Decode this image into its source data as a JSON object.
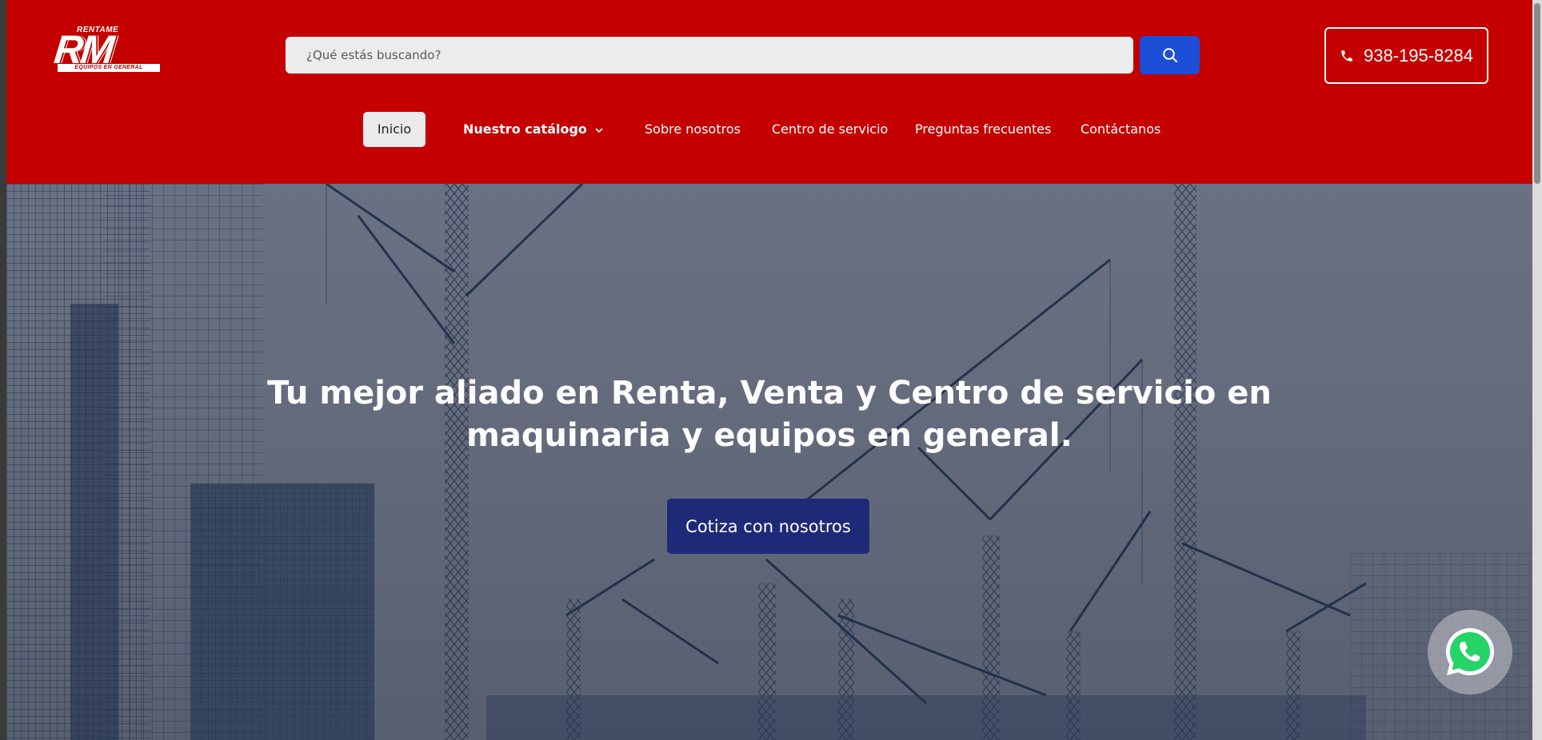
{
  "logo": {
    "brand": "RENTAME",
    "mark": "RM",
    "tagline": "EQUIPOS EN GENERAL"
  },
  "search": {
    "placeholder": "¿Qué estás buscando?",
    "button_icon": "search-icon"
  },
  "phone": {
    "number": "938-195-8284",
    "icon": "phone-icon"
  },
  "nav": {
    "items": [
      {
        "label": "Inicio",
        "active": true
      },
      {
        "label": "Nuestro catálogo",
        "has_dropdown": true
      },
      {
        "label": "Sobre nosotros"
      },
      {
        "label": "Centro de servicio"
      },
      {
        "label": "Preguntas frecuentes"
      },
      {
        "label": "Contáctanos"
      }
    ]
  },
  "hero": {
    "title_line1": "Tu mejor aliado en Renta, Venta y Centro de servicio en",
    "title_line2": "maquinaria y equipos en general.",
    "cta_label": "Cotiza con nosotros"
  },
  "floating": {
    "whatsapp_icon": "whatsapp-icon"
  },
  "colors": {
    "header_bg": "#c40000",
    "search_button": "#1d4ed8",
    "cta_bg": "#1e2a78",
    "nav_active_bg": "#ebe9ec",
    "whatsapp_green": "#25d366"
  }
}
